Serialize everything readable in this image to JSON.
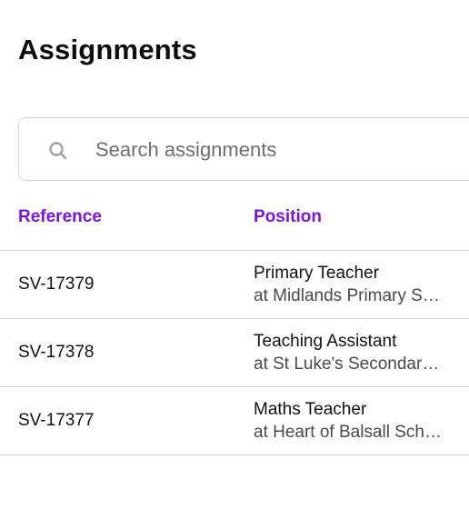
{
  "header": {
    "title": "Assignments"
  },
  "search": {
    "placeholder": "Search assignments",
    "value": ""
  },
  "icons": {
    "search": "search-icon"
  },
  "colors": {
    "accent": "#7b16d9"
  },
  "table": {
    "columns": [
      "Reference",
      "Position"
    ],
    "rows": [
      {
        "reference": "SV-17379",
        "position": "Primary Teacher",
        "organisation": "at Midlands Primary School"
      },
      {
        "reference": "SV-17378",
        "position": "Teaching Assistant",
        "organisation": "at St Luke's Secondary School"
      },
      {
        "reference": "SV-17377",
        "position": "Maths Teacher",
        "organisation": "at Heart of Balsall School"
      }
    ]
  }
}
